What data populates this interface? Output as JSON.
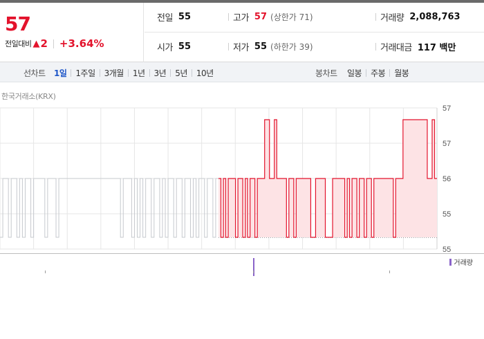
{
  "summary": {
    "price": "57",
    "change_label": "전일대비",
    "change_arrow": "▲",
    "change_amount": "2",
    "change_percent": "+3.64%",
    "prev_close_label": "전일",
    "prev_close": "55",
    "high_label": "고가",
    "high": "57",
    "upper_limit": "(상한가 71)",
    "volume_label": "거래량",
    "volume": "2,088,763",
    "open_label": "시가",
    "open": "55",
    "low_label": "저가",
    "low": "55",
    "lower_limit": "(하한가 39)",
    "trade_value_label": "거래대금",
    "trade_value": "117 백만"
  },
  "line_tabs": {
    "label": "선차트",
    "items": [
      {
        "label": "1일",
        "active": true
      },
      {
        "label": "1주일",
        "active": false
      },
      {
        "label": "3개월",
        "active": false
      },
      {
        "label": "1년",
        "active": false
      },
      {
        "label": "3년",
        "active": false
      },
      {
        "label": "5년",
        "active": false
      },
      {
        "label": "10년",
        "active": false
      }
    ]
  },
  "candle_tabs": {
    "label": "봉차트",
    "items": [
      {
        "label": "일봉"
      },
      {
        "label": "주봉"
      },
      {
        "label": "월봉"
      }
    ]
  },
  "source_label": "한국거래소(KRX)",
  "volume_legend": "거래량",
  "colors": {
    "up": "#e3132c",
    "area_fill": "#fde3e5",
    "prev_day_line": "#c6c9ce",
    "grid": "#e6e6e6",
    "volume": "#8a63c9"
  },
  "chart_data": {
    "type": "line",
    "y_axis_labels": [
      "57",
      "57",
      "56",
      "55",
      "55"
    ],
    "ylim": [
      55.4,
      56.6
    ],
    "baseline": 55.5,
    "previous_day": [
      55.5,
      56.0,
      56.0,
      55.5,
      56.0,
      56.0,
      55.5,
      56.0,
      55.5,
      56.0,
      56.0,
      55.5,
      56.0,
      56.0,
      56.0,
      56.0,
      55.5,
      56.0,
      56.0,
      56.0,
      55.5,
      56.0,
      56.0,
      56.0,
      56.0,
      56.0,
      56.0,
      56.0,
      56.0,
      56.0,
      56.0,
      56.0,
      56.0,
      56.0,
      56.0,
      56.0,
      56.0,
      56.0,
      56.0,
      56.0,
      56.0,
      56.0,
      56.0,
      55.5,
      56.0,
      56.0,
      56.0,
      55.5,
      56.0,
      55.5,
      56.0,
      55.5,
      56.0,
      56.0,
      55.5,
      56.0,
      56.0,
      55.5,
      56.0,
      55.5,
      56.0,
      56.0,
      55.5,
      56.0,
      56.0,
      55.5,
      56.0,
      56.0,
      55.5,
      56.0,
      55.5,
      56.0,
      56.0,
      55.5,
      56.0,
      56.0,
      55.5,
      56.0
    ],
    "today": [
      56.0,
      55.5,
      56.0,
      55.5,
      56.0,
      56.0,
      56.0,
      55.5,
      56.0,
      56.0,
      55.5,
      56.0,
      55.5,
      56.0,
      56.0,
      55.5,
      56.0,
      56.0,
      56.0,
      56.5,
      56.5,
      56.0,
      56.0,
      56.5,
      56.0,
      56.0,
      56.0,
      56.0,
      55.5,
      56.0,
      56.0,
      55.5,
      56.0,
      56.0,
      56.0,
      56.0,
      56.0,
      56.0,
      55.5,
      55.5,
      56.0,
      56.0,
      56.0,
      56.0,
      55.5,
      55.5,
      55.5,
      56.0,
      56.0,
      56.0,
      56.0,
      56.0,
      55.5,
      56.0,
      55.5,
      56.0,
      56.0,
      55.5,
      56.0,
      56.0,
      55.5,
      56.0,
      56.0,
      55.5,
      56.0,
      56.0,
      56.0,
      56.0,
      56.0,
      56.0,
      56.0,
      56.0,
      55.5,
      56.0,
      56.0,
      56.0,
      56.5,
      56.5,
      56.5,
      56.5,
      56.5,
      56.5,
      56.5,
      56.5,
      56.5,
      56.5,
      56.0,
      56.0,
      56.5,
      56.0
    ],
    "grid": true
  }
}
